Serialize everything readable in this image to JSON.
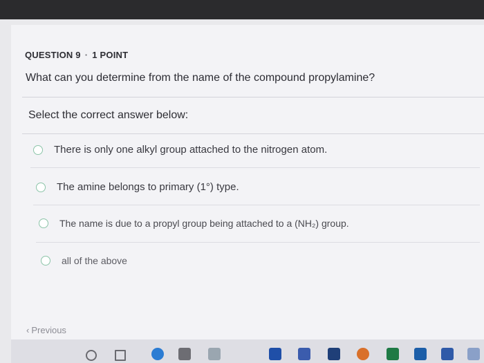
{
  "question": {
    "number_label": "QUESTION 9",
    "separator": "·",
    "points_label": "1 POINT",
    "text": "What can you determine from the name of the compound propylamine?"
  },
  "instruction": "Select the correct answer below:",
  "options": [
    {
      "label": "There is only one alkyl group attached to the nitrogen atom.",
      "selected": false
    },
    {
      "label": "The amine belongs to primary (1°) type.",
      "selected": false
    },
    {
      "label": "The name is due to a propyl group being attached to a (NH₂) group.",
      "selected": false
    },
    {
      "label": "all of the above",
      "selected": false
    }
  ],
  "navigation": {
    "previous_arrow": "‹",
    "previous_label": "Previous"
  },
  "colors": {
    "radio_border": "#8bc4a8",
    "text": "#2c2c33",
    "background": "#f3f3f6"
  },
  "taskbar_icons": [
    "search-icon",
    "task-view-icon",
    "edge-icon",
    "file-explorer-icon",
    "store-icon",
    "dropbox-icon",
    "onenote-icon",
    "onedrive-icon",
    "firefox-icon",
    "excel-icon",
    "acrobat-icon",
    "word-icon"
  ]
}
